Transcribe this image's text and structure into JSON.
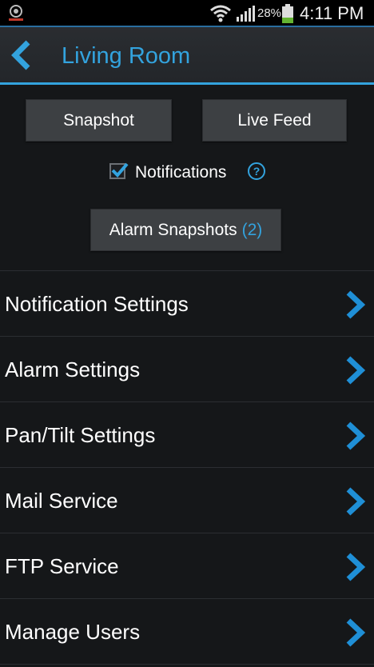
{
  "status_bar": {
    "battery_percent": "28%",
    "time": "4:11 PM",
    "icons": [
      "app-logo-icon",
      "wifi-icon",
      "signal-icon",
      "battery-icon"
    ]
  },
  "header": {
    "title": "Living Room",
    "back_icon": "chevron-left-icon"
  },
  "actions": {
    "snapshot_label": "Snapshot",
    "live_feed_label": "Live Feed",
    "notifications_label": "Notifications",
    "notifications_checked": true,
    "help_glyph": "?",
    "alarm_snapshots_label": "Alarm Snapshots",
    "alarm_snapshots_count": "(2)"
  },
  "menu": {
    "items": [
      {
        "label": "Notification Settings"
      },
      {
        "label": "Alarm Settings"
      },
      {
        "label": "Pan/Tilt Settings"
      },
      {
        "label": "Mail Service"
      },
      {
        "label": "FTP Service"
      },
      {
        "label": "Manage Users"
      }
    ]
  },
  "colors": {
    "accent": "#33a3de",
    "background": "#151719",
    "button": "#3d4043"
  }
}
